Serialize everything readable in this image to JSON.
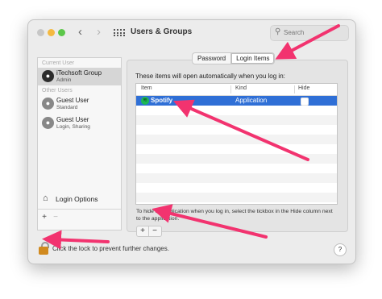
{
  "window": {
    "title": "Users & Groups",
    "search_placeholder": "Search"
  },
  "sidebar": {
    "current_label": "Current User",
    "other_label": "Other Users",
    "users": [
      {
        "name": "iTechsoft Group",
        "role": "Admin"
      },
      {
        "name": "Guest User",
        "role": "Standard"
      },
      {
        "name": "Guest User",
        "role": "Login, Sharing"
      }
    ],
    "login_options": "Login Options",
    "add": "+",
    "remove": "−"
  },
  "tabs": [
    "Password",
    "Login Items"
  ],
  "login_items": {
    "heading": "These items will open automatically when you log in:",
    "columns": [
      "Item",
      "Kind",
      "Hide"
    ],
    "rows": [
      {
        "name": "Spotify",
        "kind": "Application",
        "hidden": false
      }
    ],
    "help": "To hide an application when you log in, select the tickbox in the Hide column next to the application.",
    "add": "+",
    "remove": "−"
  },
  "footer": {
    "lock_text": "Click the lock to prevent further changes.",
    "help": "?"
  },
  "colors": {
    "selection": "#2f6fd6",
    "annotation_arrow": "#f2336f",
    "lock": "#d18a1f"
  }
}
